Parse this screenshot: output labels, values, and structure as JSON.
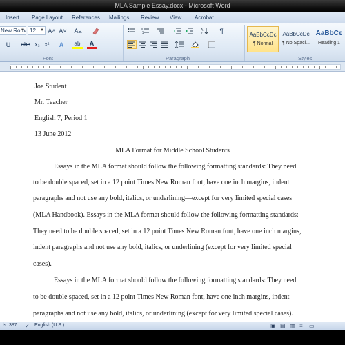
{
  "window": {
    "title": "MLA Sample Essay.docx - Microsoft Word"
  },
  "tabs": [
    "Insert",
    "Page Layout",
    "References",
    "Mailings",
    "Review",
    "View",
    "Acrobat"
  ],
  "ribbon": {
    "font_name": "New Roma",
    "font_size": "12",
    "font_group_label": "Font",
    "paragraph_group_label": "Paragraph",
    "styles_group_label": "Styles",
    "grow_font": "A˄",
    "shrink_font": "A˅",
    "change_case": "Aa",
    "underline": "U",
    "strikethrough": "abc",
    "subscript": "x₂",
    "superscript": "x²",
    "text_effects": "A",
    "highlight": "ab",
    "font_color": "A",
    "pilcrow": "¶",
    "styles": [
      {
        "sample": "AaBbCcDc",
        "name": "¶ Normal",
        "selected": true
      },
      {
        "sample": "AaBbCcDc",
        "name": "¶ No Spaci...",
        "selected": false
      },
      {
        "sample": "AaBbCє",
        "name": "Heading 1",
        "selected": false
      }
    ],
    "colors": {
      "accent": "#1e395b",
      "highlight_yellow": "#ffff00",
      "font_red": "#e02020"
    }
  },
  "document": {
    "header_lines": [
      "Joe Student",
      "Mr. Teacher",
      "English  7, Period 1",
      "13 June 2012"
    ],
    "title": "MLA Format for Middle School Students",
    "paragraphs": [
      [
        "Essays in the MLA format should follow the following formatting standards: They need",
        "to be double spaced, set in a 12 point Times  New Roman font, have one inch margins,  indent",
        "paragraphs and not use any bold, italics, or underlining—except for very limited special  cases",
        "(MLA Handbook). Essays in the MLA format should follow the following formatting standards:",
        "They need to be double spaced, set in a 12 point Times  New Roman font, have one inch margins,",
        "indent paragraphs and not use any bold, italics, or underlining (except for very limited special",
        "cases)."
      ],
      [
        "Essays in the MLA format should follow the following formatting standards: They need",
        "to be double spaced, set in a 12 point Times  New Roman font, have one inch margins,  indent",
        "paragraphs and not use any bold, italics, or underlining (except for very limited special  cases)."
      ]
    ]
  },
  "status": {
    "words": "ls: 387",
    "language": "English (U.S.)"
  }
}
